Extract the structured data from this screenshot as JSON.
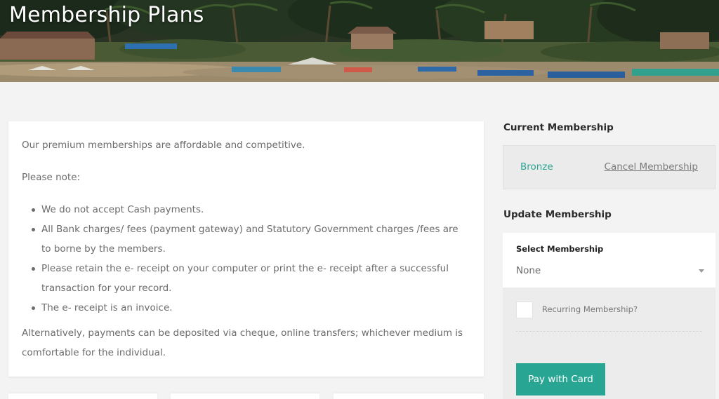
{
  "header": {
    "title": "Membership Plans"
  },
  "info": {
    "intro": "Our premium memberships are affordable and competitive.",
    "note_label": "Please note:",
    "bullets": [
      "We do not accept Cash payments.",
      "All Bank charges/ fees (payment gateway) and Statutory Government charges /fees are to borne by the members.",
      "Please retain the e- receipt on your computer or print the e- receipt after a successful transaction for your record.",
      "The e- receipt is an invoice."
    ],
    "closing": "Alternatively, payments can be deposited via cheque, online transfers; whichever medium is comfortable for the individual."
  },
  "current_membership": {
    "heading": "Current Membership",
    "level": "Bronze",
    "cancel_label": "Cancel Membership"
  },
  "update_membership": {
    "heading": "Update Membership",
    "select_label": "Select Membership",
    "select_value": "None",
    "recurring_label": "Recurring Membership?",
    "recurring_checked": false,
    "pay_button_label": "Pay with Card"
  },
  "colors": {
    "accent": "#29a594",
    "page_background": "#f3f3f3",
    "heading_text": "#2b2b2b",
    "body_text": "#6b6b6b"
  }
}
